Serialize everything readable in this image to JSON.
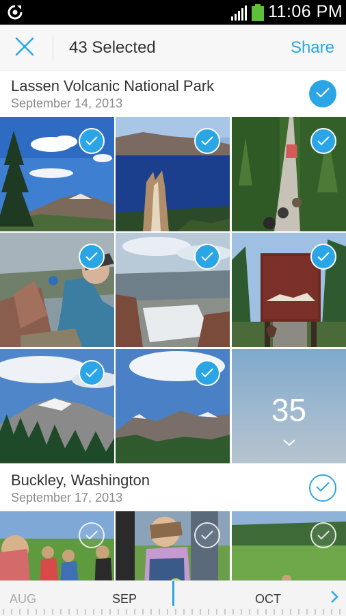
{
  "status_bar": {
    "time": "11:06 PM",
    "icons": [
      "sync-icon",
      "signal-icon",
      "battery-icon"
    ]
  },
  "action_bar": {
    "close_icon": "close-icon",
    "selected_label": "43 Selected",
    "share_label": "Share"
  },
  "sections": [
    {
      "title": "Lassen Volcanic National Park",
      "date": "September 14, 2013",
      "all_selected": true,
      "photos": [
        {
          "subject": "pine tree and mountains",
          "selected": true
        },
        {
          "subject": "crater lake",
          "selected": true
        },
        {
          "subject": "suspension bridge in forest",
          "selected": true
        },
        {
          "subject": "hiker on rocky summit",
          "selected": true
        },
        {
          "subject": "valley vista with snow",
          "selected": true
        },
        {
          "subject": "park entrance sign",
          "selected": true
        },
        {
          "subject": "snowy peak and forest",
          "selected": true
        },
        {
          "subject": "mountain range",
          "selected": true
        }
      ],
      "more_count": "35"
    },
    {
      "title": "Buckley, Washington",
      "date": "September 17, 2013",
      "all_selected": false,
      "photos": [
        {
          "subject": "picnic on lawn",
          "selected": false
        },
        {
          "subject": "child with apples",
          "selected": false
        },
        {
          "subject": "kids on field",
          "selected": false
        }
      ]
    }
  ],
  "timeline": {
    "months": [
      "AUG",
      "SEP",
      "OCT"
    ],
    "active_month": "SEP"
  },
  "colors": {
    "accent": "#2aa6e6",
    "status_bar": "#000000",
    "action_bar": "#f7f7f7",
    "battery": "#5fbf3a"
  }
}
